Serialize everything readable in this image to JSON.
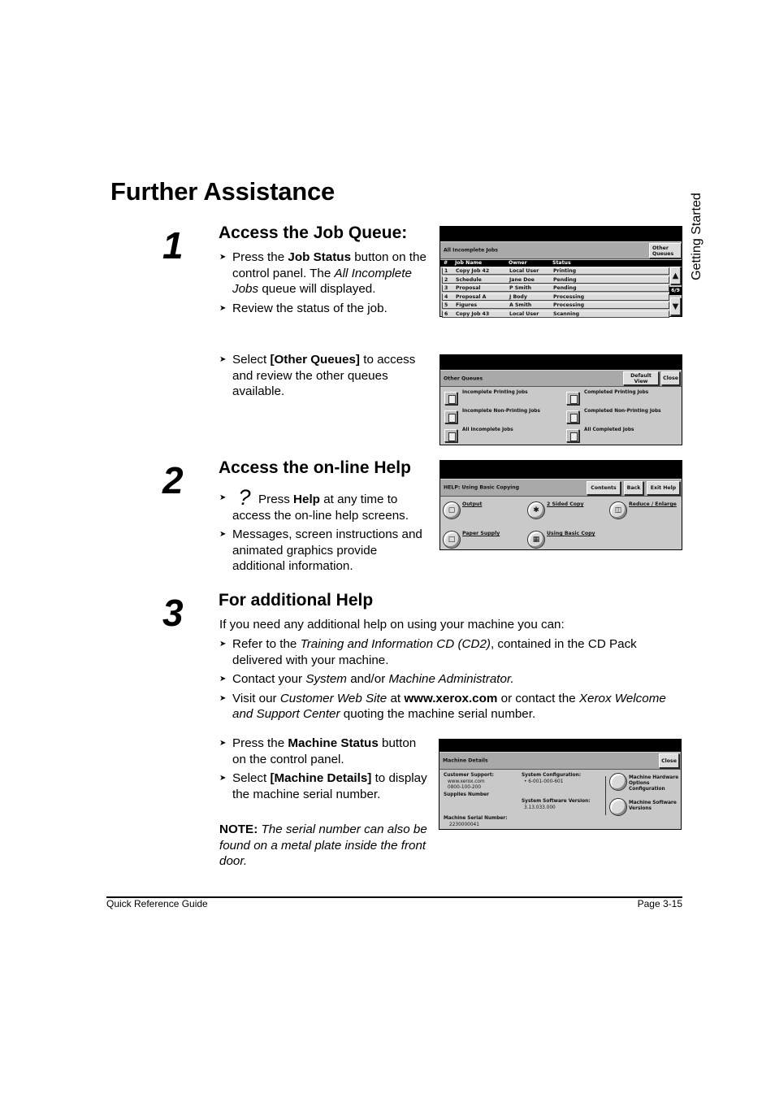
{
  "page": {
    "title": "Further Assistance",
    "side_tab": "Getting Started",
    "footer_left": "Quick Reference Guide",
    "footer_right": "Page 3-15"
  },
  "steps": [
    {
      "number": "1",
      "heading": "Access the Job Queue:",
      "bullets": [
        {
          "parts": [
            {
              "t": "Press the "
            },
            {
              "t": "Job Status",
              "b": true
            },
            {
              "t": " button on the control panel. The "
            },
            {
              "t": "All Incomplete Jobs",
              "i": true
            },
            {
              "t": " queue will displayed."
            }
          ]
        },
        {
          "parts": [
            {
              "t": "Review the status of the job."
            }
          ]
        }
      ],
      "bullets_2": [
        {
          "parts": [
            {
              "t": "Select "
            },
            {
              "t": "[Other Queues]",
              "b": true
            },
            {
              "t": " to access and review the other queues available."
            }
          ]
        }
      ]
    },
    {
      "number": "2",
      "heading": "Access the on-line Help",
      "help_glyph": "?",
      "bullets": [
        {
          "parts": [
            {
              "t": "Press "
            },
            {
              "t": "Help",
              "b": true
            },
            {
              "t": " at any time to access the on-line help screens."
            }
          ]
        },
        {
          "parts": [
            {
              "t": "Messages, screen instructions and animated graphics provide additional information."
            }
          ]
        }
      ]
    },
    {
      "number": "3",
      "heading": "For additional Help",
      "intro": "If you need any additional help on using your machine you can:",
      "bullets": [
        {
          "parts": [
            {
              "t": "Refer to the "
            },
            {
              "t": "Training and Information CD (CD2)",
              "i": true
            },
            {
              "t": ", contained in the CD Pack delivered with your machine."
            }
          ]
        },
        {
          "parts": [
            {
              "t": "Contact your "
            },
            {
              "t": "System",
              "i": true
            },
            {
              "t": " and/or "
            },
            {
              "t": "Machine Administrator.",
              "i": true
            }
          ]
        },
        {
          "parts": [
            {
              "t": "Visit our "
            },
            {
              "t": "Customer Web Site",
              "i": true
            },
            {
              "t": " at "
            },
            {
              "t": "www.xerox.com",
              "b": true
            },
            {
              "t": " or contact the "
            },
            {
              "t": "Xerox Welcome and Support Center",
              "i": true
            },
            {
              "t": " quoting the machine serial number."
            }
          ]
        }
      ],
      "bullets_2": [
        {
          "parts": [
            {
              "t": "Press the "
            },
            {
              "t": "Machine Status",
              "b": true
            },
            {
              "t": " button on the control panel."
            }
          ]
        },
        {
          "parts": [
            {
              "t": "Select "
            },
            {
              "t": "[Machine Details]",
              "b": true
            },
            {
              "t": " to display the machine serial number."
            }
          ]
        }
      ],
      "note_label": "NOTE:",
      "note_text": " The serial number can also be found on a metal plate inside the front door."
    }
  ],
  "screens": {
    "job_queue": {
      "title": "All Incomplete Jobs",
      "other_button": "Other Queues",
      "columns": [
        "#",
        "Job Name",
        "Owner",
        "Status"
      ],
      "rows": [
        [
          "1",
          "Copy Job 42",
          "Local User",
          "Printing"
        ],
        [
          "2",
          "Schedule",
          "Jane Doe",
          "Pending"
        ],
        [
          "3",
          "Proposal",
          "P Smith",
          "Pending"
        ],
        [
          "4",
          "Proposal A",
          "J Body",
          "Processing"
        ],
        [
          "5",
          "Figures",
          "A Smith",
          "Processing"
        ],
        [
          "6",
          "Copy Job 43",
          "Local User",
          "Scanning"
        ]
      ],
      "page_indicator": "6/9",
      "scroll_up_icon": "▲",
      "scroll_down_icon": "▼"
    },
    "other_queues": {
      "title": "Other Queues",
      "buttons": [
        "Default View",
        "Close"
      ],
      "options": [
        "Incomplete Printing Jobs",
        "Completed Printing Jobs",
        "Incomplete Non-Printing Jobs",
        "Completed Non-Printing Jobs",
        "All Incomplete Jobs",
        "All Completed Jobs"
      ]
    },
    "help": {
      "title": "HELP:  Using Basic Copying",
      "buttons": [
        "Contents",
        "Back",
        "Exit Help"
      ],
      "topics": [
        "Output",
        "2 Sided Copy",
        "Reduce / Enlarge",
        "Paper Supply",
        "Using Basic Copy"
      ]
    },
    "machine_details": {
      "title": "Machine Details",
      "close": "Close",
      "customer_support_label": "Customer Support:",
      "customer_support_web": "www.xerox.com",
      "customer_support_phone": "0800-100-200",
      "supplies_label": "Supplies Number",
      "serial_label": "Machine Serial Number:",
      "serial_value": "2230000041",
      "sys_config_label": "System Configuration:",
      "sys_config_value": "• 6-001-000-601",
      "sys_sw_label": "System Software Version:",
      "sys_sw_value": "3.13.033.000",
      "buttons": [
        "Machine Hardware Options Configuration",
        "Machine Software Versions"
      ]
    }
  }
}
